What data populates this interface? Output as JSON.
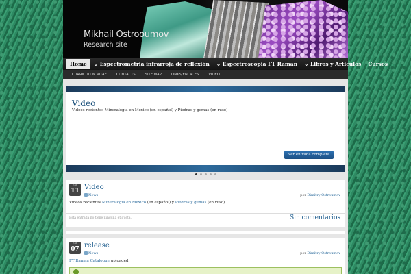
{
  "header": {
    "title": "Mikhail Ostrooumov",
    "description": "Research site"
  },
  "nav": [
    {
      "label": "Home",
      "dropdown": false,
      "active": true
    },
    {
      "label": "Espectrometria infrarroja de reflexión",
      "dropdown": true
    },
    {
      "label": "Espectroscopia FT Raman",
      "dropdown": true
    },
    {
      "label": "Libros y Articulos",
      "dropdown": true
    },
    {
      "label": "Cursos",
      "dropdown": false
    }
  ],
  "subnav": [
    "CURRICULUM VITAE",
    "CONTACTS",
    "SITE MAP",
    "LINKS/ENLACES",
    "VIDEO"
  ],
  "slider": {
    "title": "Video",
    "text": "Videos recientes  Mineralogia en Mexico (en español) y Piedras y gemas (en ruso)",
    "button": "Ver entrada completa",
    "dots": 5,
    "active_dot": 0
  },
  "posts": [
    {
      "month": "Ene",
      "day": "11",
      "title": "Video",
      "category": "News",
      "by_prefix": "por",
      "author": "Dimitry Ostroumov",
      "body_prefix": "Videos recientes  ",
      "link1": "Mineralogia en Mexico",
      "body_mid": " (en español) y ",
      "link2": "Piedras y gemas",
      "body_suffix": " (en ruso)",
      "tags": "Esta entrada no tiene ninguna etiqueta.",
      "comments": "Sin comentarios"
    },
    {
      "month": "Ene",
      "day": "07",
      "title": "release",
      "category": "News",
      "by_prefix": "por",
      "author": "Dimitry Ostroumov",
      "body_link": "FT Raman Catalogue",
      "body_suffix": " uploaded"
    }
  ]
}
